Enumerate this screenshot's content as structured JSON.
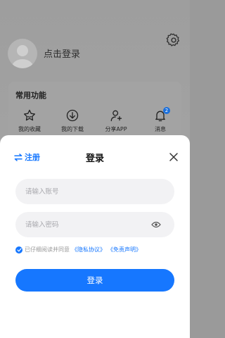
{
  "background": {
    "login_link": "点击登录",
    "card_title": "常用功能",
    "shortcuts": [
      {
        "label": "我的收藏",
        "icon": "star-icon"
      },
      {
        "label": "我的下载",
        "icon": "download-icon"
      },
      {
        "label": "分享APP",
        "icon": "share-user-icon"
      },
      {
        "label": "消息",
        "icon": "bell-icon",
        "badge": "2"
      }
    ]
  },
  "sheet": {
    "switch_label": "注册",
    "title": "登录",
    "account_placeholder": "请输入账号",
    "password_placeholder": "请输入密码",
    "agree_text": "已仔细阅读并同意",
    "privacy_link": "《隐私协议》",
    "disclaimer_link": "《免责声明》",
    "login_button": "登录"
  },
  "colors": {
    "accent": "#1677ff",
    "sheet_bg": "#ffffff",
    "field_bg": "#f2f2f4"
  }
}
